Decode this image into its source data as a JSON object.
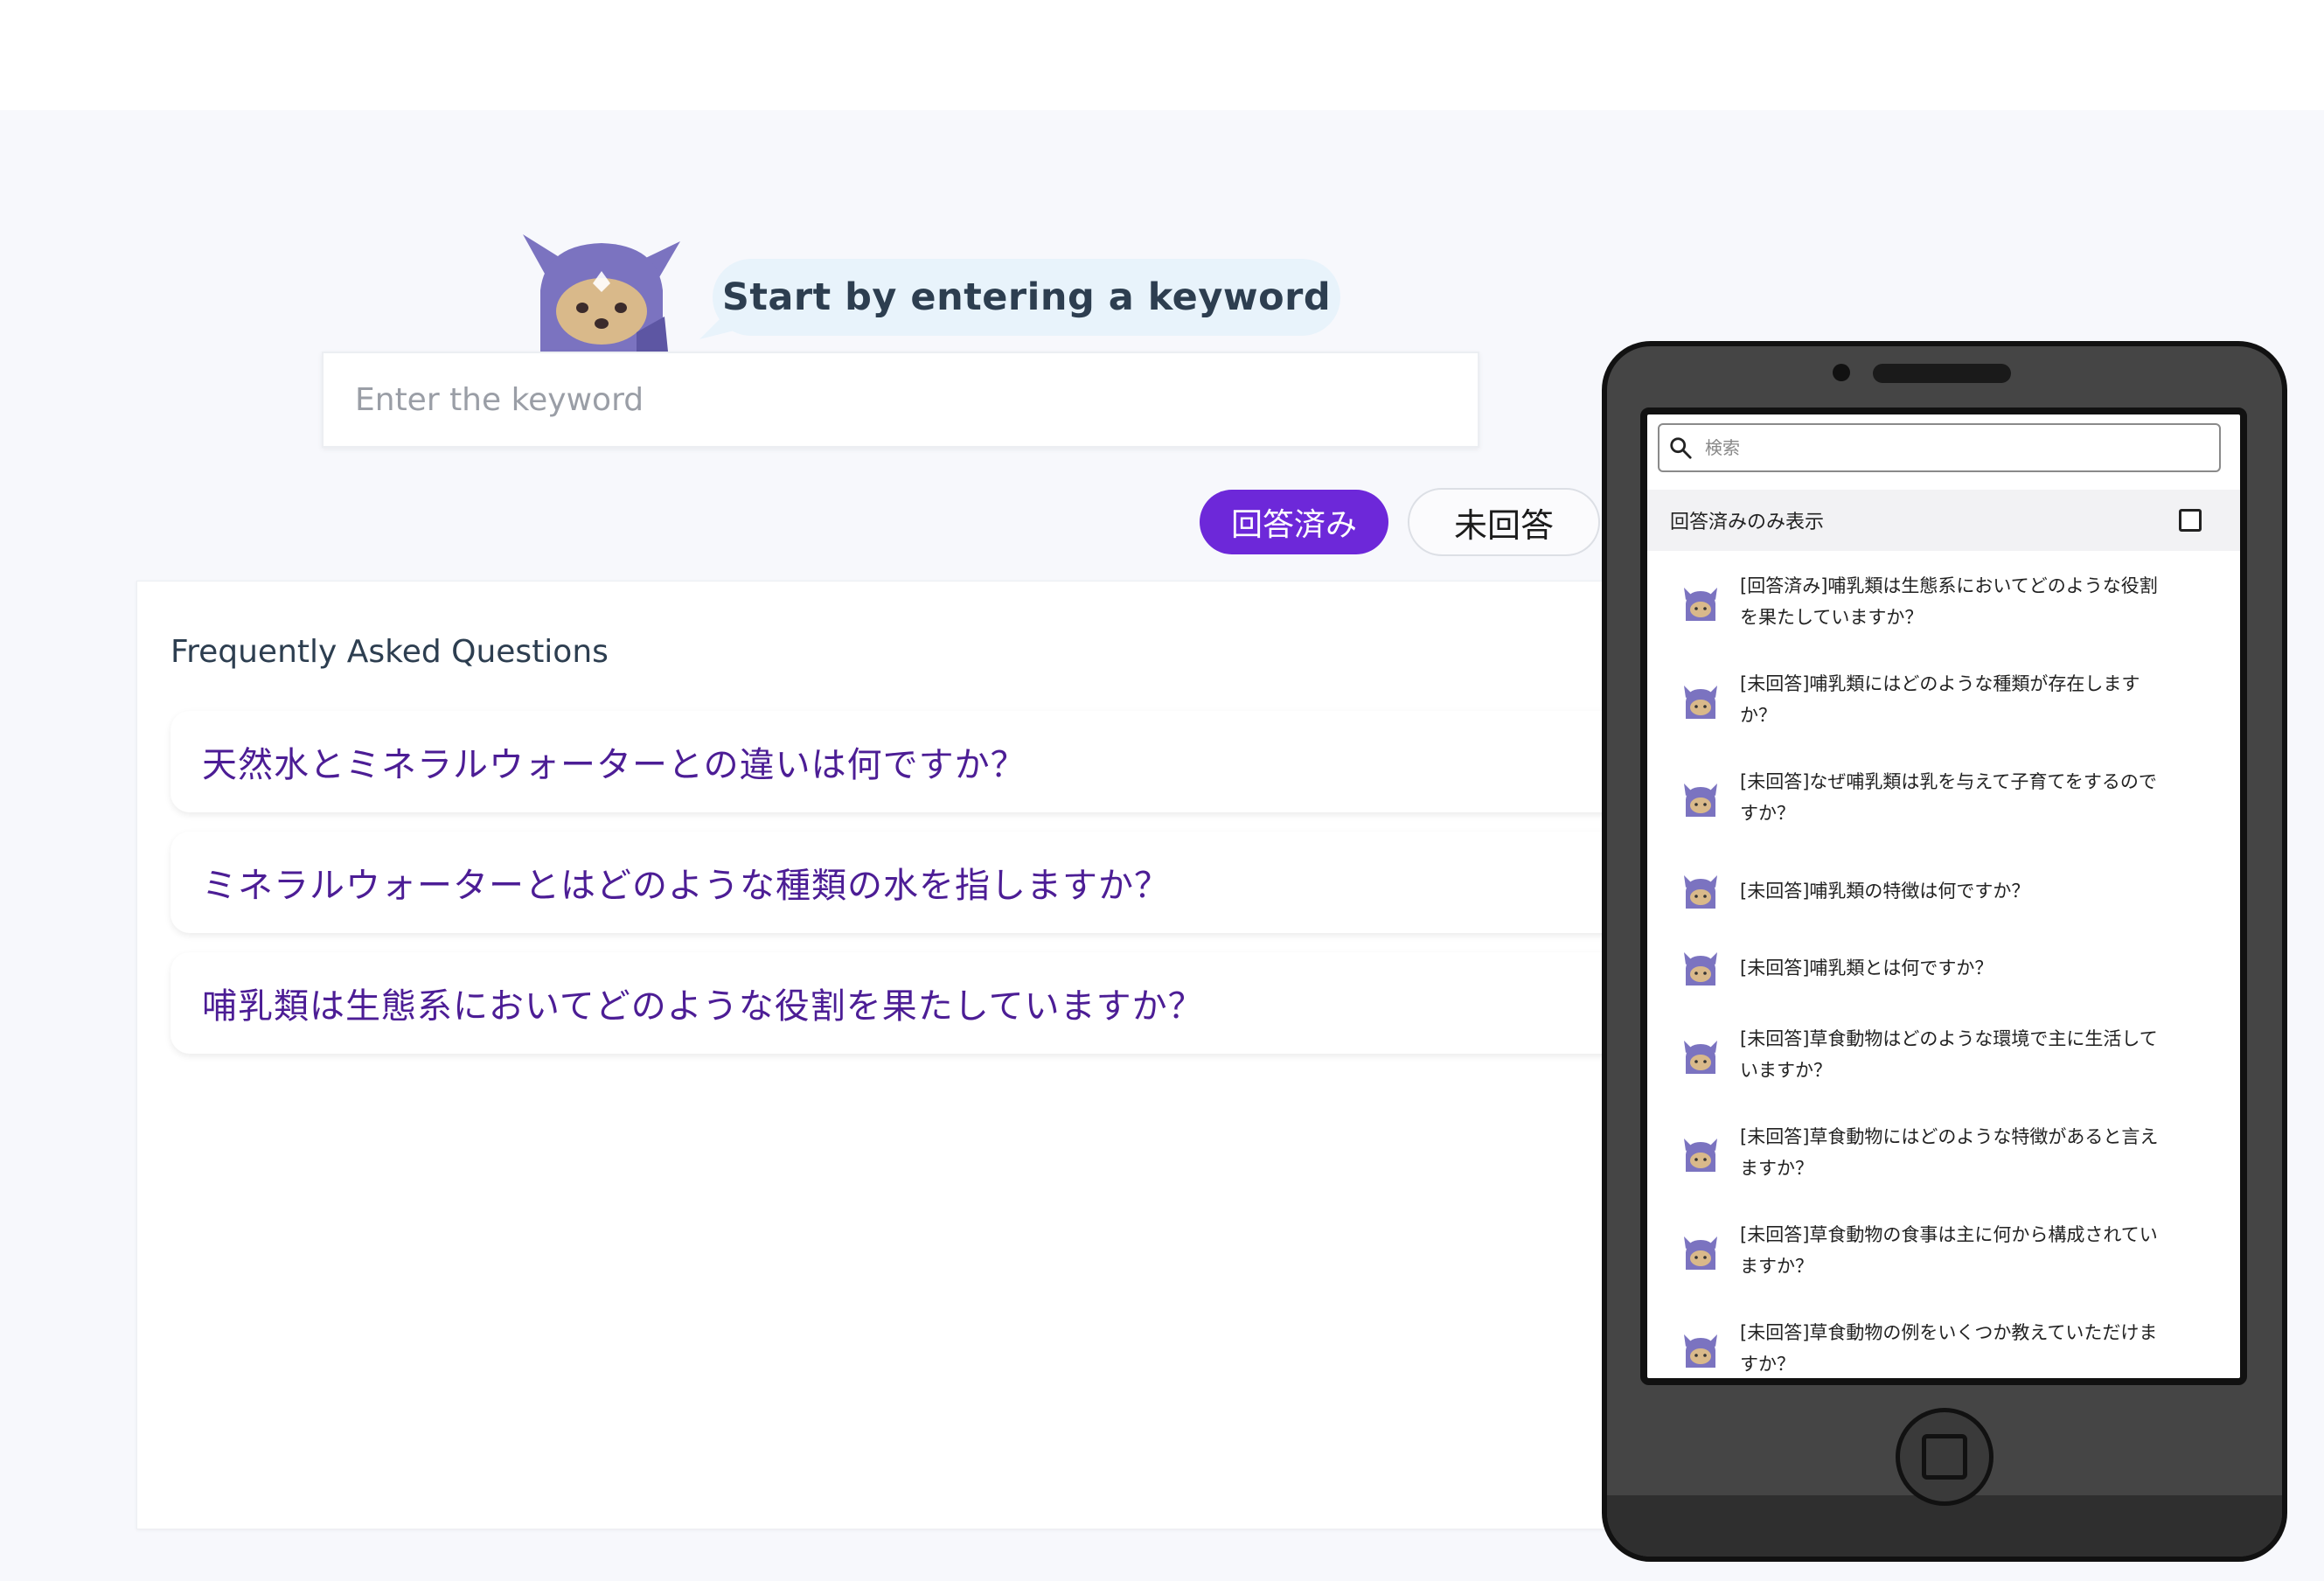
{
  "prompt": {
    "bubble_text": "Start by entering a keyword"
  },
  "search": {
    "placeholder": "Enter the keyword",
    "value": ""
  },
  "filters": {
    "answered_label": "回答済み",
    "unanswered_label": "未回答"
  },
  "faq": {
    "title": "Frequently Asked Questions",
    "items": [
      {
        "question": "天然水とミネラルウォーターとの違いは何ですか？"
      },
      {
        "question": "ミネラルウォーターとはどのような種類の水を指しますか？"
      },
      {
        "question": "哺乳類は生態系においてどのような役割を果たしていますか？"
      }
    ]
  },
  "phone": {
    "search_placeholder": "検索",
    "filter_label": "回答済みのみ表示",
    "filter_checked": false,
    "items": [
      {
        "line1": "[回答済み]哺乳類は生態系においてどのような役割",
        "line2": "を果たしていますか？"
      },
      {
        "line1": "[未回答]哺乳類にはどのような種類が存在します",
        "line2": "か？"
      },
      {
        "line1": "[未回答]なぜ哺乳類は乳を与えて子育てをするので",
        "line2": "すか？"
      },
      {
        "line1": "[未回答]哺乳類の特徴は何ですか？",
        "line2": ""
      },
      {
        "line1": "[未回答]哺乳類とは何ですか？",
        "line2": ""
      },
      {
        "line1": "[未回答]草食動物はどのような環境で主に生活して",
        "line2": "いますか？"
      },
      {
        "line1": "[未回答]草食動物にはどのような特徴があると言え",
        "line2": "ますか？"
      },
      {
        "line1": "[未回答]草食動物の食事は主に何から構成されてい",
        "line2": "ますか？"
      },
      {
        "line1": "[未回答]草食動物の例をいくつか教えていただけま",
        "line2": "すか？"
      }
    ]
  },
  "colors": {
    "accent": "#6d28d9",
    "question_text": "#4c1d95",
    "bubble_bg": "#e8f3fb",
    "mascot_purple": "#7b73c0"
  }
}
